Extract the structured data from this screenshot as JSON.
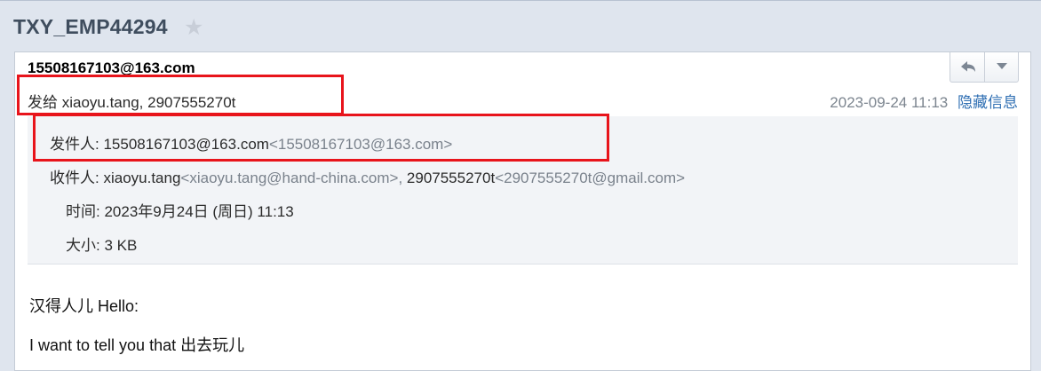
{
  "header": {
    "title": "TXY_EMP44294",
    "star_icon": "star-icon"
  },
  "email": {
    "sender": "15508167103@163.com",
    "recipients_summary": "发给 xiaoyu.tang, 2907555270t",
    "date": "2023-09-24 11:13",
    "hide_info_label": "隐藏信息",
    "details": {
      "from_label": "发件人:",
      "from_name": "15508167103@163.com",
      "from_addr": "<15508167103@163.com>",
      "to_label": "收件人:",
      "to_name_1": "xiaoyu.tang",
      "to_addr_1": "<xiaoyu.tang@hand-china.com>,",
      "to_name_2": "2907555270t",
      "to_addr_2": "<2907555270t@gmail.com>",
      "time_label": "时间:",
      "time_value": "2023年9月24日 (周日) 11:13",
      "size_label": "大小:",
      "size_value": "3 KB"
    },
    "body": {
      "greeting": "汉得人儿 Hello:",
      "line1": "I want to tell you that 出去玩儿"
    }
  },
  "toolbar": {
    "reply_icon": "reply-icon",
    "more_icon": "chevron-down-icon"
  },
  "colors": {
    "highlight": "#e8141b",
    "link": "#2f6fb3"
  }
}
